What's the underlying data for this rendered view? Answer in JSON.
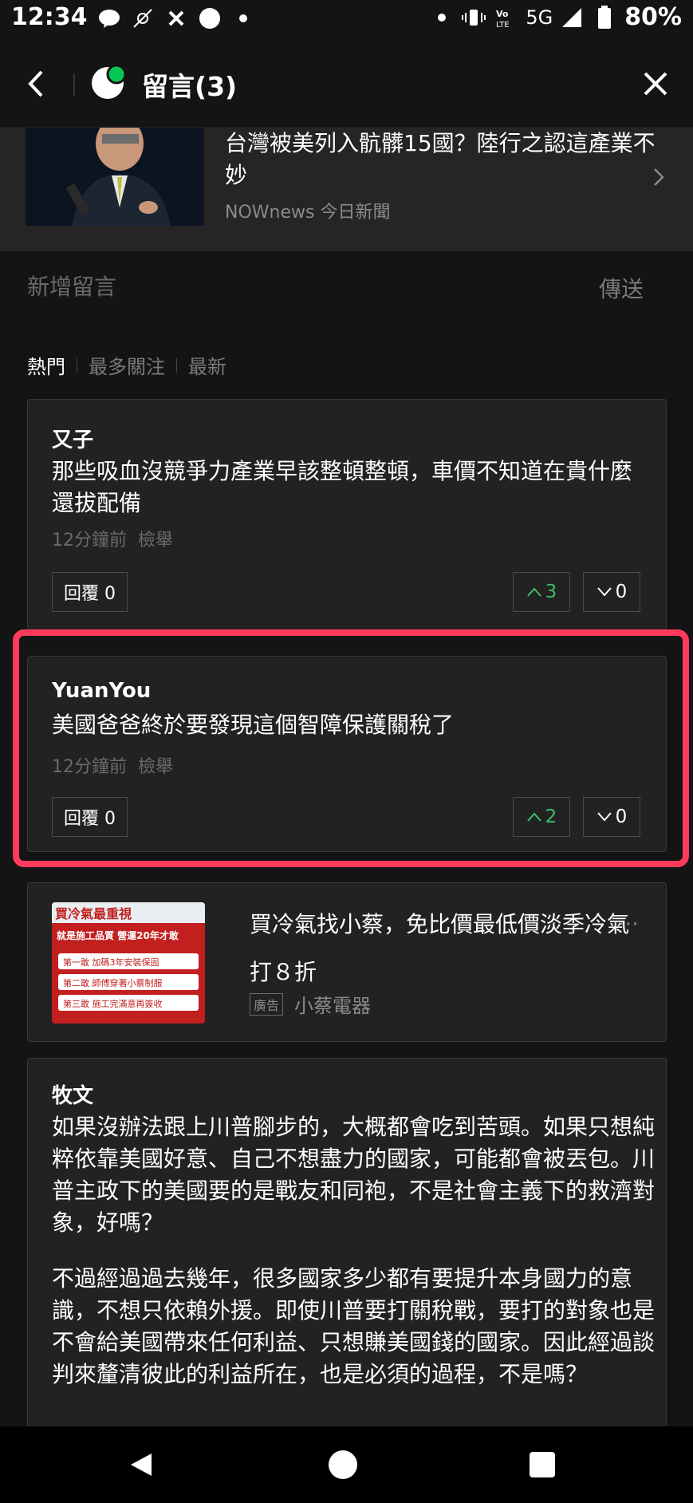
{
  "status_bar": {
    "time": "12:34",
    "network": "5G",
    "battery": "80%",
    "icons": [
      "line-icon",
      "satellite-icon",
      "cross-icon",
      "circle-icon",
      "dot-icon",
      "vibrate-icon",
      "volte-icon",
      "signal-icon",
      "battery-icon"
    ]
  },
  "header": {
    "title": "留言(3)",
    "back_icon": "chevron-left-icon",
    "close_icon": "close-icon",
    "brand_color": "#06c755"
  },
  "article": {
    "title": "台灣被美列入骯髒15國？陸行之認這產業不妙",
    "source": "NOWnews 今日新聞"
  },
  "compose": {
    "placeholder": "新增留言",
    "send_label": "傳送"
  },
  "sort_tabs": [
    {
      "label": "熱門",
      "active": true
    },
    {
      "label": "最多關注",
      "active": false
    },
    {
      "label": "最新",
      "active": false
    }
  ],
  "comments": [
    {
      "name": "又子",
      "text": "那些吸血沒競爭力產業早該整頓整頓，車價不知道在貴什麼還拔配備",
      "time": "12分鐘前",
      "report": "檢舉",
      "reply_label": "回覆 0",
      "upvotes": "3",
      "downvotes": "0"
    },
    {
      "name": "YuanYou",
      "text": "美國爸爸終於要發現這個智障保護關稅了",
      "time": "12分鐘前",
      "report": "檢舉",
      "reply_label": "回覆 0",
      "upvotes": "2",
      "downvotes": "0"
    },
    {
      "name": "牧文",
      "text_p1": "如果沒辦法跟上川普腳步的，大概都會吃到苦頭。如果只想純粹依靠美國好意、自己不想盡力的國家，可能都會被丟包。川普主政下的美國要的是戰友和同袍，不是社會主義下的救濟對象，好嗎？",
      "text_p2": "不過經過過去幾年，很多國家多少都有要提升本身國力的意識，不想只依賴外援。即使川普要打關稅戰，要打的對象也是不會給美國帶來任何利益、只想賺美國錢的國家。因此經過談判來釐清彼此的利益所在，也是必須的過程，不是嗎？"
    }
  ],
  "ad": {
    "title": "買冷氣找小蔡，免比價最低價淡季冷氣打８折",
    "badge": "廣告",
    "advertiser": "小蔡電器",
    "more": "⋯",
    "image_text": {
      "headline": "買冷氣最重視",
      "sub": "就是施工品質 營運20年才敢",
      "line1": "第一敢 加碼3年安裝保固",
      "line2": "第二敢 師傅穿著小蔡制服",
      "line3": "第三敢 施工完滿意再簽收"
    }
  },
  "colors": {
    "upvote": "#3cc06a",
    "highlight": "#ff3b5c",
    "background": "#141414",
    "card": "#222222"
  }
}
